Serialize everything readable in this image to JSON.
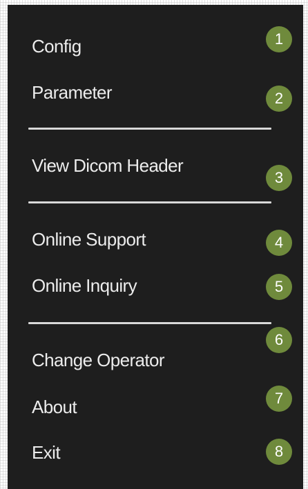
{
  "menu": {
    "items": [
      {
        "label": "Config"
      },
      {
        "label": "Parameter"
      },
      {
        "label": "View Dicom Header"
      },
      {
        "label": "Online Support"
      },
      {
        "label": "Online Inquiry"
      },
      {
        "label": "Change Operator"
      },
      {
        "label": "About"
      },
      {
        "label": "Exit"
      }
    ]
  },
  "badges": [
    "1",
    "2",
    "3",
    "4",
    "5",
    "6",
    "7",
    "8"
  ],
  "colors": {
    "menu_background": "#1e1e1e",
    "menu_text": "#ececec",
    "separator": "#d9d9d9",
    "badge_background": "#6f8a3c",
    "badge_text": "#ffffff"
  }
}
